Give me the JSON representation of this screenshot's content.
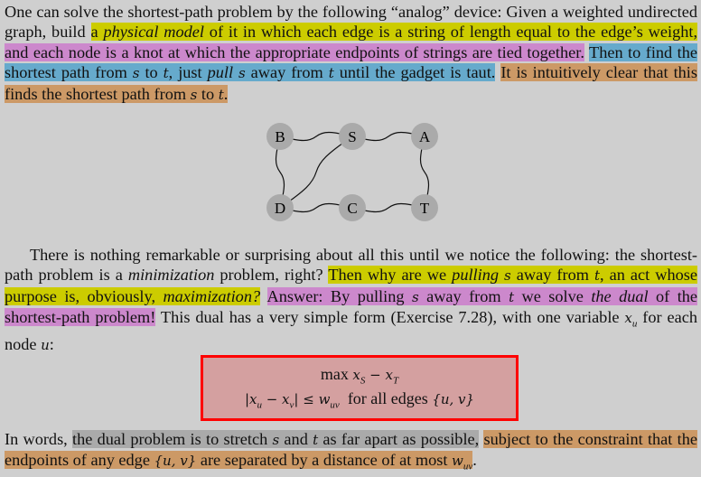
{
  "paragraph1": {
    "s1": "One can solve the shortest-path problem by the following “analog” device: Given a weighted undirected graph, build ",
    "h1a": "a ",
    "h1b": "physical model",
    "h1c": " of it in which each edge is a string of length equal to the edge’s weight,",
    "h2": "and each node is a knot at which the appropriate endpoints of strings are tied together.",
    "h3a": "Then to find the shortest path from ",
    "s": "s",
    "to": " to ",
    "t": "t",
    "h3b": ", just ",
    "pull": "pull",
    "h3c": " away from ",
    "h3d": " until the gadget is taut.",
    "h4a": "It is intuitively clear that this finds the shortest path from ",
    "dot": "."
  },
  "graph": {
    "nodes": [
      "B",
      "S",
      "A",
      "D",
      "C",
      "T"
    ],
    "edges": [
      [
        "B",
        "S"
      ],
      [
        "S",
        "A"
      ],
      [
        "B",
        "D"
      ],
      [
        "S",
        "D"
      ],
      [
        "D",
        "C"
      ],
      [
        "C",
        "T"
      ],
      [
        "A",
        "T"
      ]
    ],
    "node_color": "#aaaaaa"
  },
  "paragraph2": {
    "a": "There is nothing remarkable or surprising about all this until we notice the following: the shortest-path problem is a ",
    "minimization": "minimization",
    "b": " problem, right? ",
    "h1a": "Then why are we ",
    "pulling": "pulling",
    "h1b": " away from ",
    "h1c": ", an act whose purpose is, obviously, ",
    "maximization": "maximization?",
    "h2a": "Answer: By pulling ",
    "h2b": " away from ",
    "h2c": " we solve ",
    "dual": "the dual",
    "h2d": " of the shortest-path problem!",
    "c": " This dual has a very simple form (Exercise 7.28), with one variable ",
    "xu": "x",
    "u": "u",
    "d": " for each node ",
    "colon": ":"
  },
  "formula": {
    "objective_prefix": "max ",
    "objective": "x",
    "sub_S": "S",
    "minus": " − x",
    "sub_T": "T",
    "constraint": "|x",
    "c_sub_u": "u",
    "c_mid": " − x",
    "c_sub_v": "v",
    "c_le": "| ≤ w",
    "c_sub_uv": "uv",
    "for_all": "  for all edges ",
    "set": "{u, v}",
    "border_color": "#ff0000",
    "fill_color": "#d4a0a0"
  },
  "paragraph3": {
    "a": "In words, ",
    "h1a": "the dual problem is to stretch ",
    "h1b": " and ",
    "h1c": " as far apart as possible,",
    "h2a": "subject to the constraint that the endpoints of any edge ",
    "set": "{u, v}",
    "h2b": " are separated by a distance of at most ",
    "w": "w",
    "uv": "uv",
    "dot": "."
  },
  "highlight_colors": {
    "yellow": "#cccc00",
    "pink": "#cc88cc",
    "blue": "#66aacc",
    "orange": "#cc9966",
    "gray": "#aaaaaa"
  }
}
